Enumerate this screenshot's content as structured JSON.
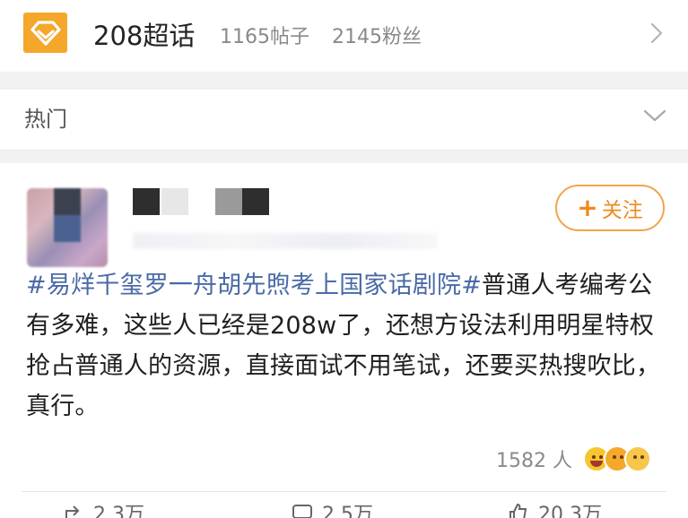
{
  "topic": {
    "logo_icon": "diamond-icon",
    "name": "208超话",
    "posts": "1165帖子",
    "fans": "2145粉丝"
  },
  "section": {
    "label": "热门"
  },
  "post": {
    "follow_label": "关注",
    "follow_plus": "+",
    "hashtag": "#易烊千玺罗一舟胡先煦考上国家话剧院#",
    "body": "普通人考编考公有多难，这些人已经是208w了，还想方设法利用明星特权抢占普通人的资源，直接面试不用笔试，还要买热搜吹比，真行。",
    "reaction_count": "1582 人",
    "actions": [
      {
        "icon": "share-icon",
        "label": "2.3万"
      },
      {
        "icon": "comment-icon",
        "label": "2.5万"
      },
      {
        "icon": "like-icon",
        "label": "20.3万"
      }
    ]
  },
  "colors": {
    "brand": "#f4a72a",
    "hashtag": "#4a6aa6",
    "follow": "#ef8a1e"
  }
}
